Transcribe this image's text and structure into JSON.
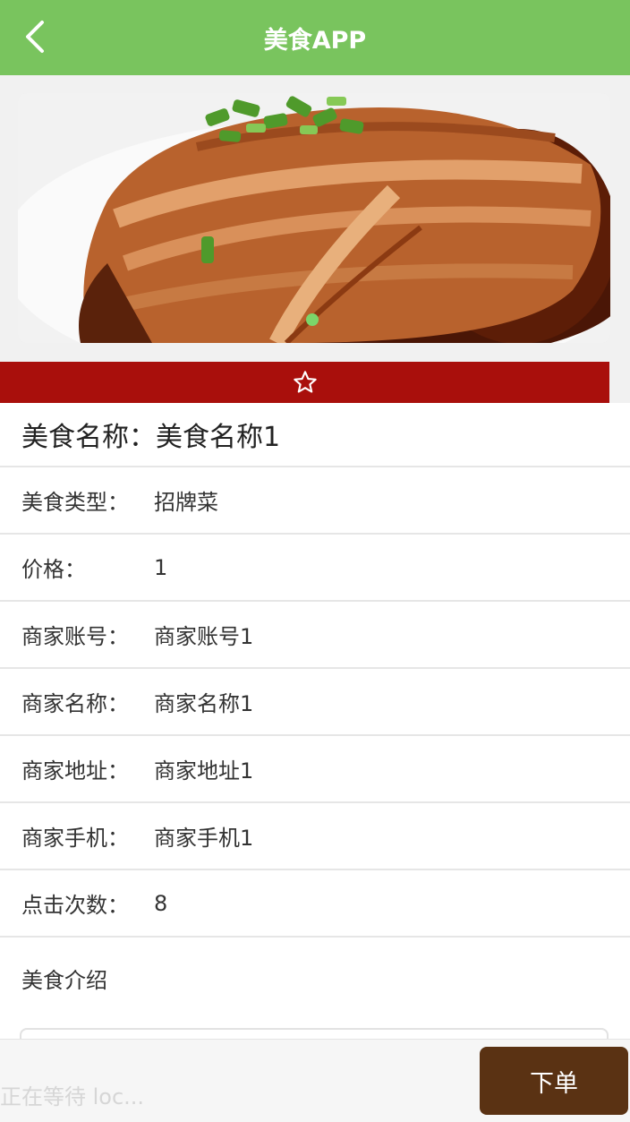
{
  "header": {
    "title": "美食APP"
  },
  "food": {
    "name_label": "美食名称：",
    "name_value": "美食名称1",
    "fields": [
      {
        "label": "美食类型：",
        "value": "招牌菜"
      },
      {
        "label": "价格：",
        "value": "1"
      },
      {
        "label": "商家账号：",
        "value": "商家账号1"
      },
      {
        "label": "商家名称：",
        "value": "商家名称1"
      },
      {
        "label": "商家地址：",
        "value": "商家地址1"
      },
      {
        "label": "商家手机：",
        "value": "商家手机1"
      },
      {
        "label": "点击次数：",
        "value": "8"
      }
    ],
    "intro_label": "美食介绍"
  },
  "footer": {
    "loading_text": "正在等待 loc...",
    "order_label": "下单"
  },
  "colors": {
    "header_bg": "#79c45e",
    "favorite_bar": "#a90f0c",
    "order_button": "#5a3213"
  }
}
